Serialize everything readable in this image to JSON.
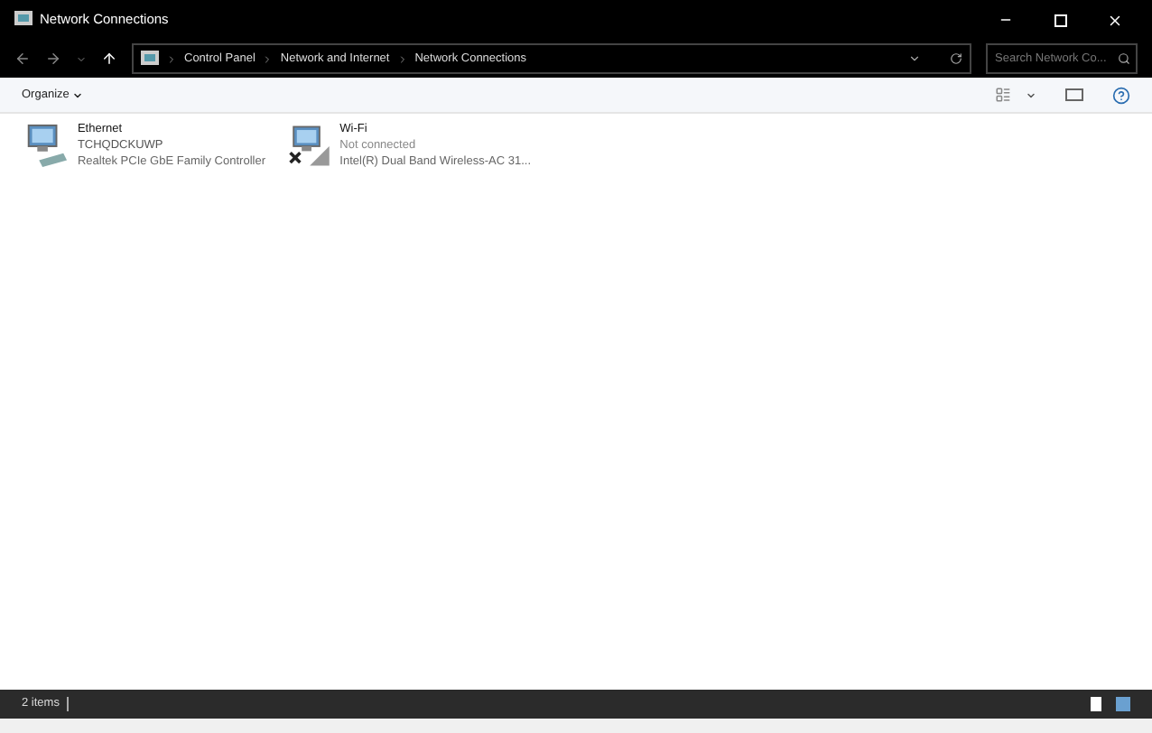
{
  "window": {
    "title": "Network Connections"
  },
  "address_bar": {
    "breadcrumbs": [
      "Control Panel",
      "Network and Internet",
      "Network Connections"
    ],
    "search": {
      "placeholder": "Search Network Co..."
    }
  },
  "toolbar": {
    "organize": "Organize"
  },
  "connections": [
    {
      "name": "Ethernet",
      "status": "TCHQDCKUWP",
      "adapter": "Realtek PCIe GbE Family Controller",
      "kind": "ethernet",
      "connected": true
    },
    {
      "name": "Wi-Fi",
      "status": "Not connected",
      "adapter": "Intel(R) Dual Band Wireless-AC 31...",
      "kind": "wifi",
      "connected": false
    }
  ],
  "status_bar": {
    "count": "2 items"
  }
}
